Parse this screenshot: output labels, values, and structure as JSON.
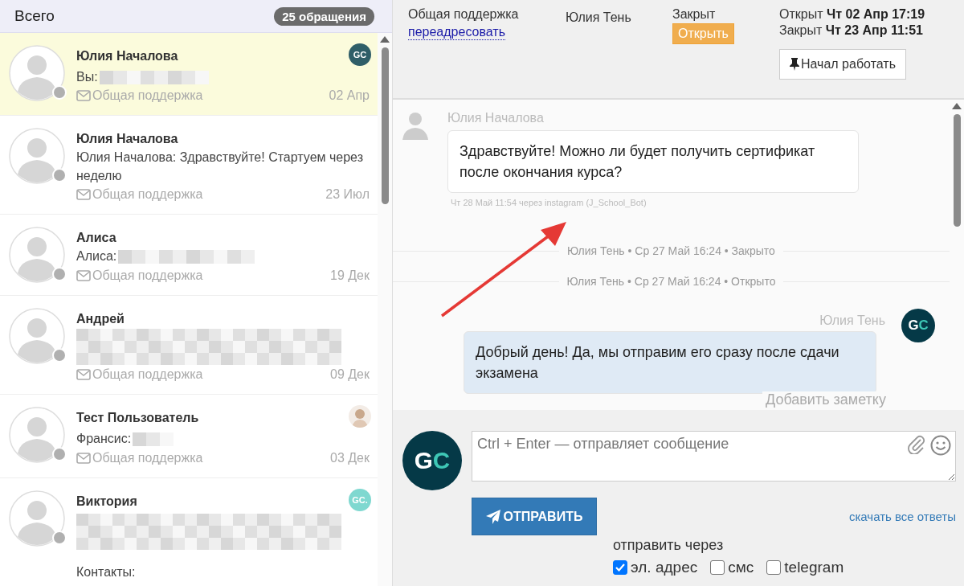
{
  "list_header": {
    "title": "Всего",
    "count": "25 обращения"
  },
  "conversations": [
    {
      "kind": "short",
      "name": "Юлия Началова",
      "preview": "Вы:",
      "channel": "Общая поддержка",
      "date": "02 Апр",
      "selected": true,
      "badge": {
        "kind": "logo",
        "text": "GC",
        "color": "#2f5e68"
      }
    },
    {
      "kind": "plain",
      "name": "Юлия Началова",
      "preview": "Юлия Началова: Здравствуйте! Стартуем через неделю",
      "channel": "Общая поддержка",
      "date": "23 Июл",
      "selected": false
    },
    {
      "kind": "wide",
      "name": "Алиса",
      "preview": "Алиса:",
      "channel": "Общая поддержка",
      "date": "19 Дек",
      "selected": false
    },
    {
      "kind": "block",
      "name": "Андрей",
      "channel": "Общая поддержка",
      "date": "09 Дек",
      "selected": false
    },
    {
      "kind": "tiny",
      "name": "Тест Пользователь",
      "preview": "Франсис:",
      "channel": "Общая поддержка",
      "date": "03 Дек",
      "selected": false,
      "badge": {
        "kind": "photo"
      }
    },
    {
      "kind": "block",
      "name": "Виктория",
      "extra": "Контакты:",
      "selected": false,
      "badge": {
        "kind": "logo",
        "text": "GC.",
        "color": "#7fd8d0"
      }
    }
  ],
  "ticket": {
    "queue": "Общая поддержка",
    "reassign_link": "переадресовать",
    "assignee": "Юлия Тень",
    "status": "Закрыт",
    "open_button": "Открыть",
    "opened_label": "Открыт",
    "opened_at": "Чт 02 Апр 17:19",
    "closed_label": "Закрыт",
    "closed_at": "Чт 23 Апр 11:51",
    "start_button": "Начал работать"
  },
  "messages": [
    {
      "kind": "incoming",
      "author": "Юлия Началова",
      "text": "Здравствуйте! Можно ли будет получить сертификат после окончания курса?",
      "meta": "Чт 28 Май 11:54 через instagram (J_School_Bot)"
    },
    {
      "kind": "event",
      "text": "Юлия Тень • Ср 27 Май 16:24 • Закрыто"
    },
    {
      "kind": "event",
      "text": "Юлия Тень •  Ср 27 Май 16:24 • Открыто"
    },
    {
      "kind": "outgoing",
      "author": "Юлия Тень",
      "avatar": "GC",
      "text": "Добрый день! Да, мы отправим его сразу после сдачи экзамена"
    }
  ],
  "annotation_arrow": true,
  "add_note": "Добавить заметку",
  "composer": {
    "avatar": "GC",
    "placeholder": "Ctrl + Enter — отправляет сообщение",
    "send_button": "ОТПРАВИТЬ",
    "download_link": "скачать все ответы",
    "send_via_label": "отправить через",
    "channels": [
      {
        "label": "эл. адрес",
        "checked": true
      },
      {
        "label": "смс",
        "checked": false
      },
      {
        "label": "telegram",
        "checked": false
      }
    ]
  }
}
